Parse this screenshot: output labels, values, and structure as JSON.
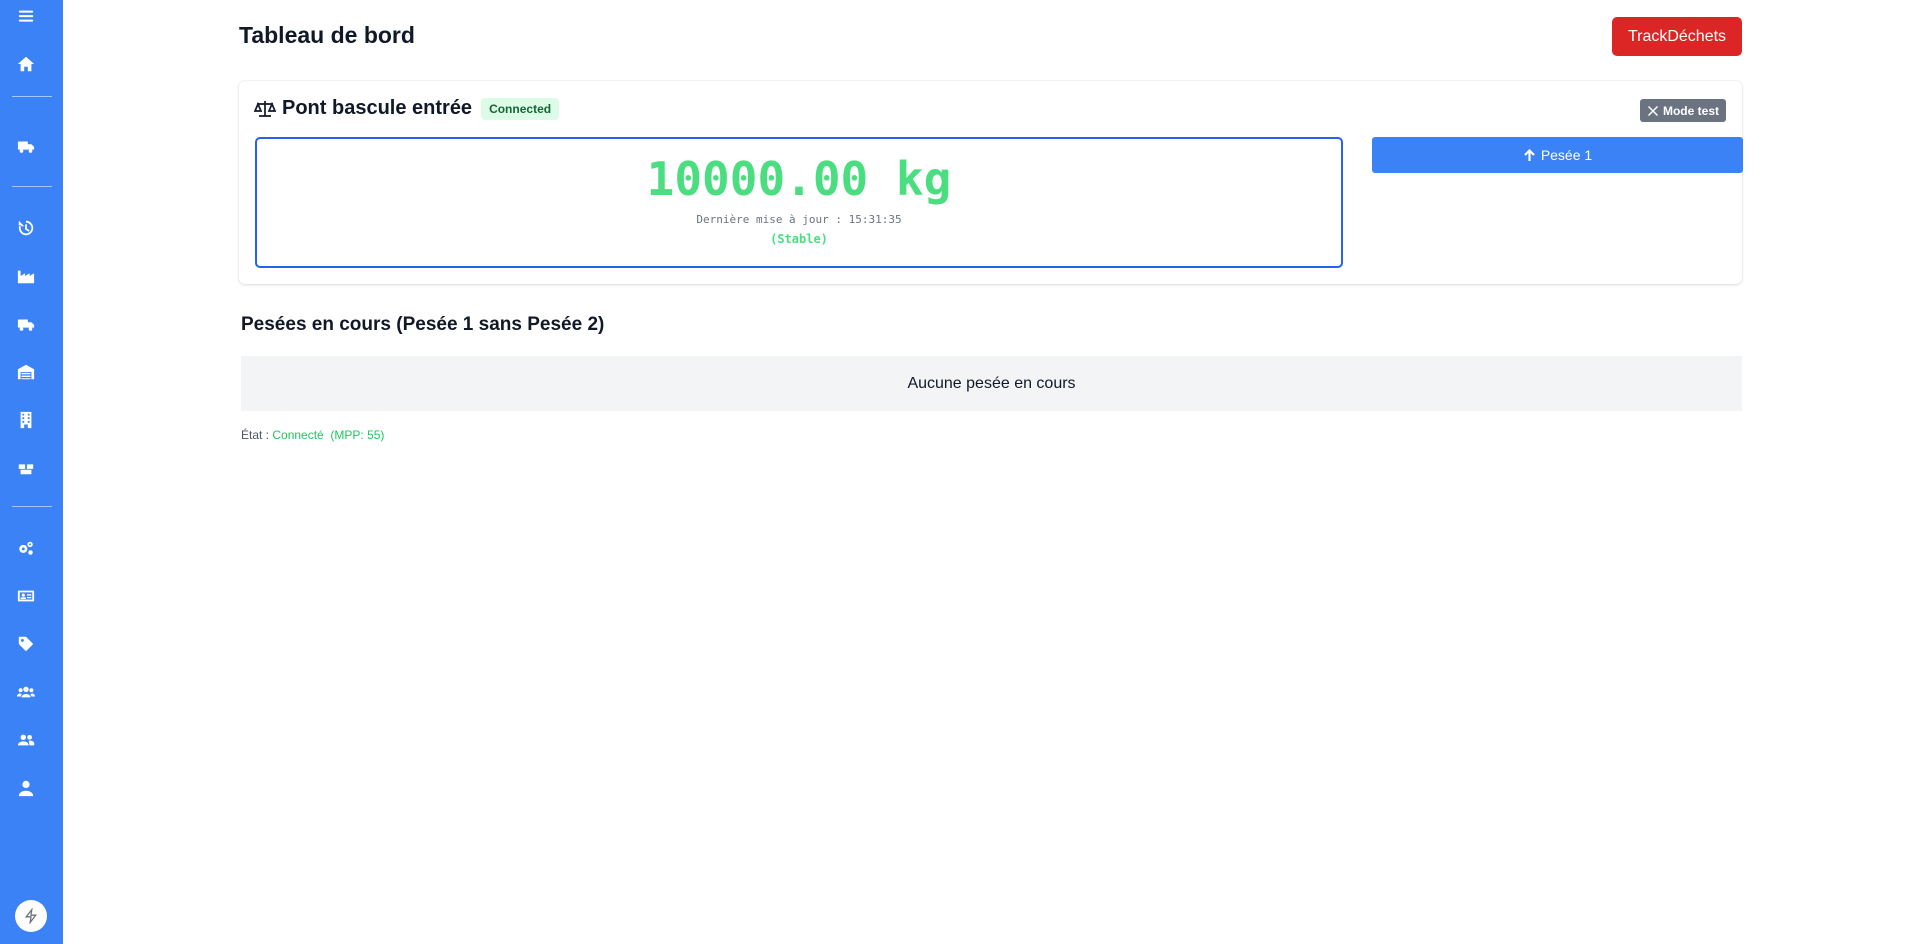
{
  "sidebar": {
    "items": [
      {
        "icon": "menu-icon"
      },
      {
        "icon": "home-icon"
      },
      {
        "icon": "truck-delivery-icon"
      },
      {
        "icon": "history-icon"
      },
      {
        "icon": "industry-icon"
      },
      {
        "icon": "truck-icon"
      },
      {
        "icon": "warehouse-icon"
      },
      {
        "icon": "building-icon"
      },
      {
        "icon": "boxes-icon"
      },
      {
        "icon": "gears-icon"
      },
      {
        "icon": "id-card-icon"
      },
      {
        "icon": "tag-icon"
      },
      {
        "icon": "users-icon"
      },
      {
        "icon": "user-group-icon"
      },
      {
        "icon": "user-icon"
      }
    ],
    "bottom_icon": "bolt-icon"
  },
  "header": {
    "title": "Tableau de bord",
    "trackdechets_label": "TrackDéchets"
  },
  "scale_card": {
    "title": "Pont bascule entrée",
    "connection_badge": "Connected",
    "mode_test_label": "Mode test",
    "weight": "10000.00 kg",
    "last_update": "Dernière mise à jour : 15:31:35",
    "status": "(Stable)",
    "pesee_button_label": "Pesée 1"
  },
  "pending": {
    "title": "Pesées en cours (Pesée 1 sans Pesée 2)",
    "empty_message": "Aucune pesée en cours"
  },
  "status_bar": {
    "label": "État :",
    "state": "Connecté",
    "mpp": "(MPP: 55)"
  },
  "colors": {
    "sidebar": "#3b82f6",
    "danger": "#dc2626",
    "weight_green": "#4ade80",
    "primary": "#3b82f6"
  }
}
